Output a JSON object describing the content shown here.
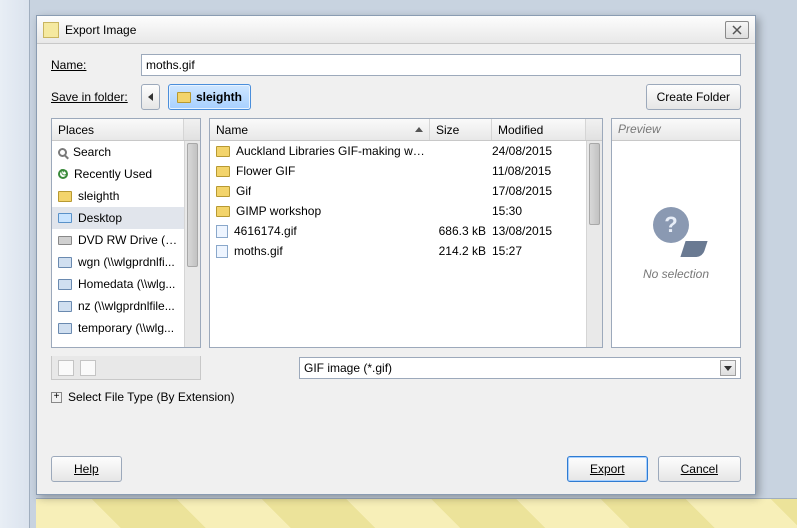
{
  "window": {
    "title": "Export Image"
  },
  "fields": {
    "name_label": "Name:",
    "name_value": "moths.gif",
    "folder_label": "Save in folder:",
    "create_folder": "Create Folder"
  },
  "path": {
    "current": "sleighth"
  },
  "places": {
    "header": "Places",
    "items": [
      {
        "icon": "search",
        "label": "Search"
      },
      {
        "icon": "recent",
        "label": "Recently Used"
      },
      {
        "icon": "folder",
        "label": "sleighth"
      },
      {
        "icon": "desktop",
        "label": "Desktop",
        "selected": true
      },
      {
        "icon": "drive",
        "label": "DVD RW Drive (E:)"
      },
      {
        "icon": "net",
        "label": "wgn (\\\\wlgprdnlfi..."
      },
      {
        "icon": "net",
        "label": "Homedata (\\\\wlg..."
      },
      {
        "icon": "net",
        "label": "nz (\\\\wlgprdnlfile..."
      },
      {
        "icon": "net",
        "label": "temporary (\\\\wlg..."
      }
    ]
  },
  "filelist": {
    "cols": {
      "name": "Name",
      "size": "Size",
      "modified": "Modified"
    },
    "rows": [
      {
        "icon": "folder",
        "name": "Auckland Libraries GIF-making works...",
        "size": "",
        "modified": "24/08/2015"
      },
      {
        "icon": "folder",
        "name": "Flower GIF",
        "size": "",
        "modified": "11/08/2015"
      },
      {
        "icon": "folder",
        "name": "Gif",
        "size": "",
        "modified": "17/08/2015"
      },
      {
        "icon": "folder",
        "name": "GIMP workshop",
        "size": "",
        "modified": "15:30"
      },
      {
        "icon": "file",
        "name": "4616174.gif",
        "size": "686.3 kB",
        "modified": "13/08/2015"
      },
      {
        "icon": "file",
        "name": "moths.gif",
        "size": "214.2 kB",
        "modified": "15:27"
      }
    ]
  },
  "filetype": {
    "selected": "GIF image (*.gif)"
  },
  "expander": {
    "label": "Select File Type (By Extension)"
  },
  "preview": {
    "header": "Preview",
    "noselection": "No selection"
  },
  "buttons": {
    "help": "Help",
    "export": "Export",
    "cancel": "Cancel"
  }
}
